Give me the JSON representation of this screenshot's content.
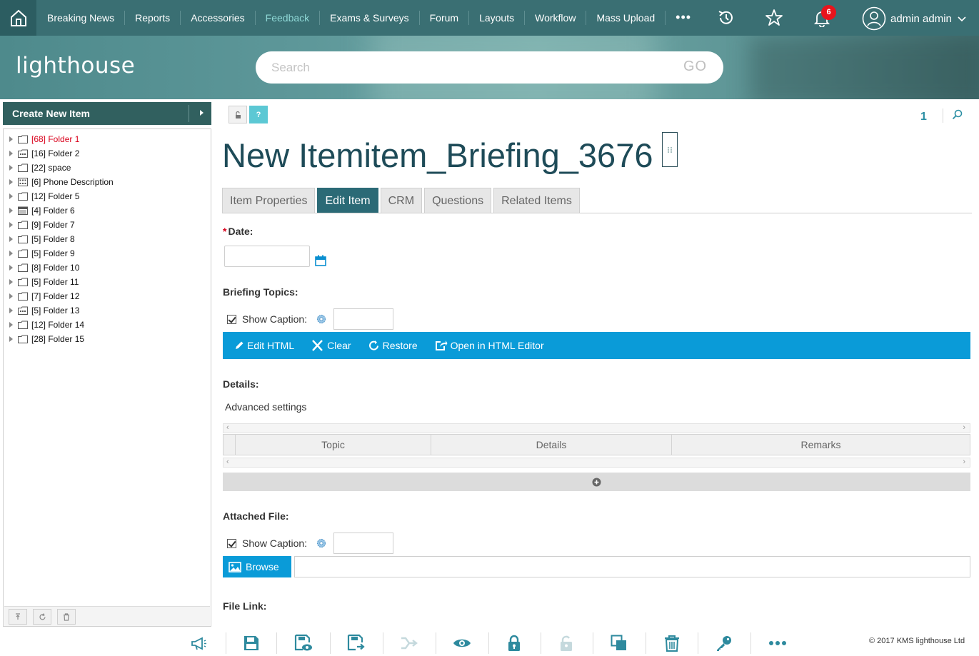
{
  "nav": {
    "items": [
      {
        "label": "Breaking News"
      },
      {
        "label": "Reports"
      },
      {
        "label": "Accessories"
      },
      {
        "label": "Feedback"
      },
      {
        "label": "Exams & Surveys"
      },
      {
        "label": "Forum"
      },
      {
        "label": "Layouts"
      },
      {
        "label": "Workflow"
      },
      {
        "label": "Mass Upload"
      }
    ],
    "more_label": "•••",
    "active_item": "Feedback",
    "notifications_count": "6",
    "user_name": "admin admin"
  },
  "banner": {
    "logo": "lighthouse",
    "search_placeholder": "Search",
    "go_label": "GO"
  },
  "sidebar": {
    "create_label": "Create New Item",
    "tree": [
      {
        "label": "[68] Folder 1",
        "icon": "folder-icon",
        "highlight": true
      },
      {
        "label": "[16] Folder 2",
        "icon": "form-folder-icon"
      },
      {
        "label": "[22] space",
        "icon": "folder-icon"
      },
      {
        "label": "[6] Phone Description",
        "icon": "grid-folder-icon"
      },
      {
        "label": "[12] Folder 5",
        "icon": "folder-icon"
      },
      {
        "label": "[4] Folder 6",
        "icon": "calendar-folder-icon"
      },
      {
        "label": "[9] Folder 7",
        "icon": "folder-icon"
      },
      {
        "label": "[5] Folder 8",
        "icon": "folder-icon"
      },
      {
        "label": "[5] Folder 9",
        "icon": "folder-icon"
      },
      {
        "label": "[8] Folder 10",
        "icon": "folder-icon"
      },
      {
        "label": "[5] Folder 11",
        "icon": "folder-icon"
      },
      {
        "label": "[7] Folder 12",
        "icon": "folder-icon"
      },
      {
        "label": "[5] Folder 13",
        "icon": "form-folder-icon"
      },
      {
        "label": "[12] Folder 14",
        "icon": "folder-icon"
      },
      {
        "label": "[28] Folder 15",
        "icon": "folder-icon"
      }
    ]
  },
  "main": {
    "page_number": "1",
    "help_label": "?",
    "title": "New Itemitem_Briefing_3676",
    "tabs": [
      {
        "label": "Item Properties"
      },
      {
        "label": "Edit Item"
      },
      {
        "label": "CRM"
      },
      {
        "label": "Questions"
      },
      {
        "label": "Related Items"
      }
    ],
    "active_tab": "Edit Item",
    "date_label": "Date:",
    "required_mark": "*",
    "briefing_label": "Briefing Topics:",
    "show_caption_label": "Show Caption:",
    "html_toolbar": {
      "edit_html": "Edit HTML",
      "clear": "Clear",
      "restore": "Restore",
      "open_editor": "Open in HTML Editor"
    },
    "details_label": "Details:",
    "advanced_label": "Advanced settings",
    "grid_columns": [
      "Topic",
      "Details",
      "Remarks"
    ],
    "scroll_left": "‹",
    "scroll_right": "›",
    "attached_file_label": "Attached File:",
    "browse_label": "Browse",
    "file_link_label": "File Link:"
  },
  "bottom_bar": {
    "copyright": "© 2017 KMS lighthouse Ltd"
  },
  "colors": {
    "nav_bg": "#3a6f73",
    "accent_blue": "#0a9bd8",
    "active_tab": "#2b6a76",
    "sidebar_header": "#31605f",
    "alert_red": "#d9001b"
  }
}
